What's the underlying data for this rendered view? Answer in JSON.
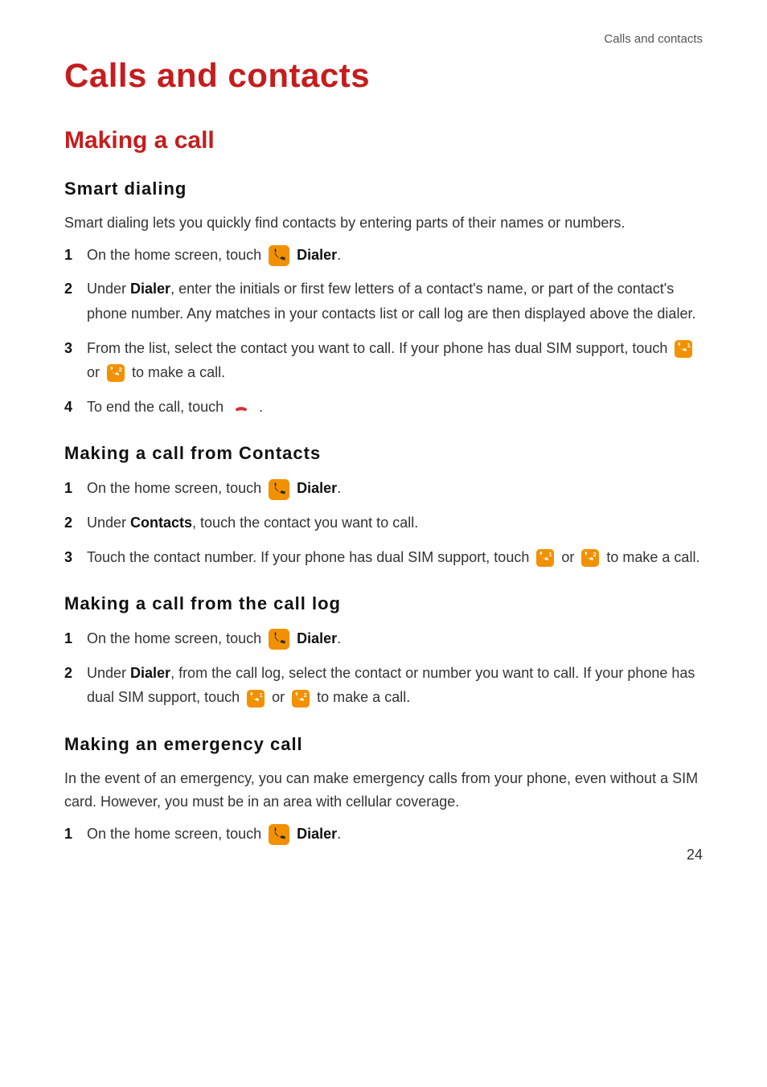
{
  "running_header": "Calls and contacts",
  "page_number": "24",
  "title": "Calls and contacts",
  "section_title": "Making a call",
  "colors": {
    "accent": "#c51d1d",
    "icon_bg": "#f29100",
    "text": "#333333"
  },
  "icons": {
    "dialer": "dialer-icon",
    "sim1": "phone-sim1-icon",
    "sim2": "phone-sim2-icon",
    "endcall": "end-call-icon"
  },
  "smart_dialing": {
    "heading": "Smart  dialing",
    "intro": "Smart dialing lets you quickly find contacts by entering parts of their names or numbers.",
    "steps": [
      {
        "num": "1",
        "pre": "On the home screen, touch ",
        "bold": "Dialer",
        "post": "."
      },
      {
        "num": "2",
        "pre": "Under ",
        "bold": "Dialer",
        "post": ", enter the initials or first few letters of a contact's name, or part of the contact's phone number. Any matches in your contacts list or call log are then displayed above the dialer."
      },
      {
        "num": "3",
        "pre": "From the list, select the contact you want to call. If your phone has dual SIM support, touch ",
        "mid": " or ",
        "post": " to make a call."
      },
      {
        "num": "4",
        "pre": "To end the call, touch ",
        "post": "."
      }
    ]
  },
  "from_contacts": {
    "heading": "Making  a  call  from  Contacts",
    "steps": [
      {
        "num": "1",
        "pre": "On the home screen, touch ",
        "bold": "Dialer",
        "post": "."
      },
      {
        "num": "2",
        "pre": "Under ",
        "bold": "Contacts",
        "post": ", touch the contact you want to call."
      },
      {
        "num": "3",
        "pre": "Touch the contact number. If your phone has dual SIM support, touch ",
        "mid": " or ",
        "post": " to make a call."
      }
    ]
  },
  "from_log": {
    "heading": "Making  a  call  from  the  call  log",
    "steps": [
      {
        "num": "1",
        "pre": "On the home screen, touch ",
        "bold": "Dialer",
        "post": "."
      },
      {
        "num": "2",
        "pre": "Under ",
        "bold": "Dialer",
        "post": ", from the call log, select the contact or number you want to call. If your phone has dual SIM support, touch ",
        "mid": " or ",
        "post2": " to make a call."
      }
    ]
  },
  "emergency": {
    "heading": "Making  an  emergency  call",
    "intro": "In the event of an emergency, you can make emergency calls from your phone, even without a SIM card. However, you must be in an area with cellular coverage.",
    "steps": [
      {
        "num": "1",
        "pre": "On the home screen, touch ",
        "bold": "Dialer",
        "post": "."
      }
    ]
  }
}
